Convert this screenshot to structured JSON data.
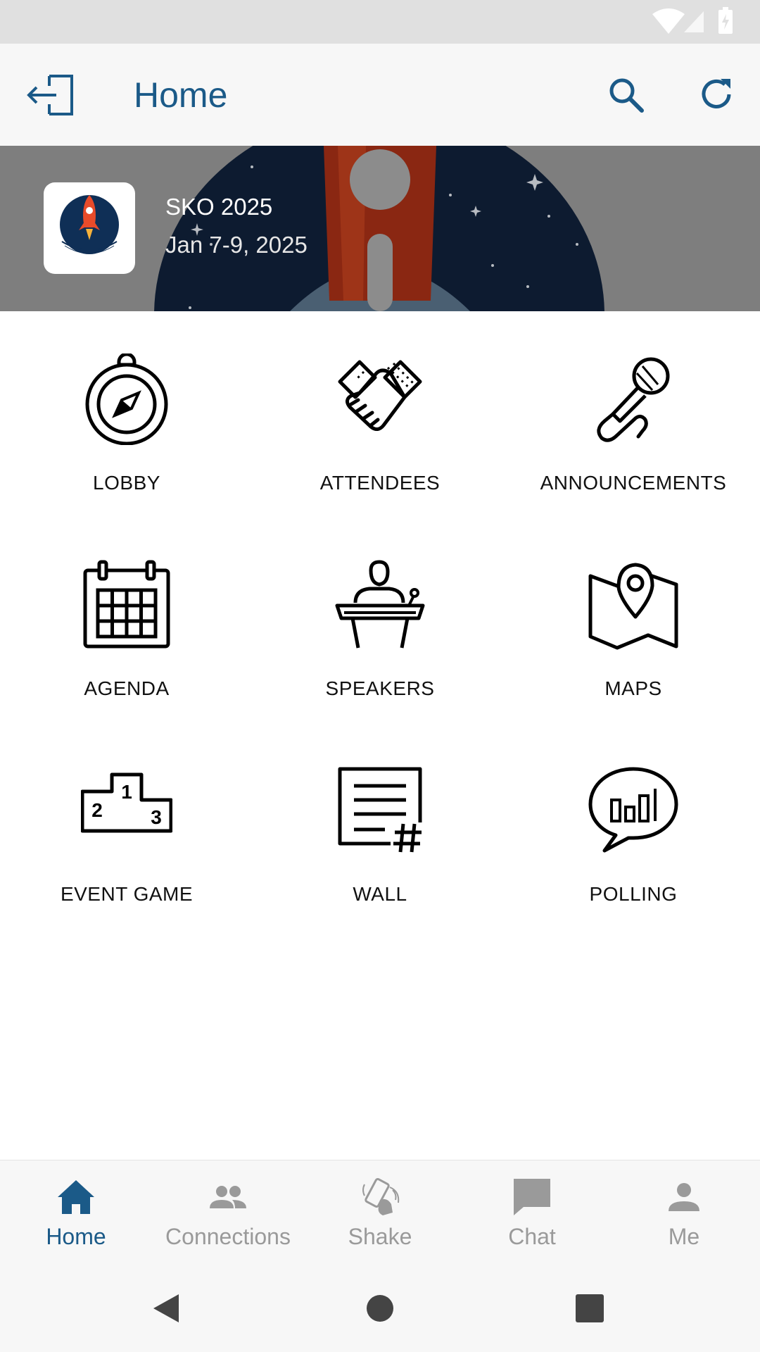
{
  "app": {
    "title": "Home"
  },
  "event": {
    "name": "SKO 2025",
    "dates": "Jan 7-9, 2025"
  },
  "tiles": [
    {
      "label": "LOBBY",
      "icon": "compass-icon"
    },
    {
      "label": "ATTENDEES",
      "icon": "handshake-icon"
    },
    {
      "label": "ANNOUNCEMENTS",
      "icon": "microphone-icon"
    },
    {
      "label": "AGENDA",
      "icon": "calendar-icon"
    },
    {
      "label": "SPEAKERS",
      "icon": "podium-speaker-icon"
    },
    {
      "label": "MAPS",
      "icon": "map-pin-icon"
    },
    {
      "label": "EVENT GAME",
      "icon": "podium-ranking-icon"
    },
    {
      "label": "WALL",
      "icon": "wall-post-hashtag-icon"
    },
    {
      "label": "POLLING",
      "icon": "chat-bar-chart-icon"
    }
  ],
  "bottom_nav": [
    {
      "label": "Home",
      "icon": "home-icon",
      "active": true
    },
    {
      "label": "Connections",
      "icon": "people-icon",
      "active": false
    },
    {
      "label": "Shake",
      "icon": "shake-phone-icon",
      "active": false
    },
    {
      "label": "Chat",
      "icon": "chat-bubble-icon",
      "active": false
    },
    {
      "label": "Me",
      "icon": "person-icon",
      "active": false
    }
  ],
  "colors": {
    "accent": "#1b5a88",
    "inactive": "#9a9a9a",
    "banner_bg": "#7e7e7e"
  }
}
